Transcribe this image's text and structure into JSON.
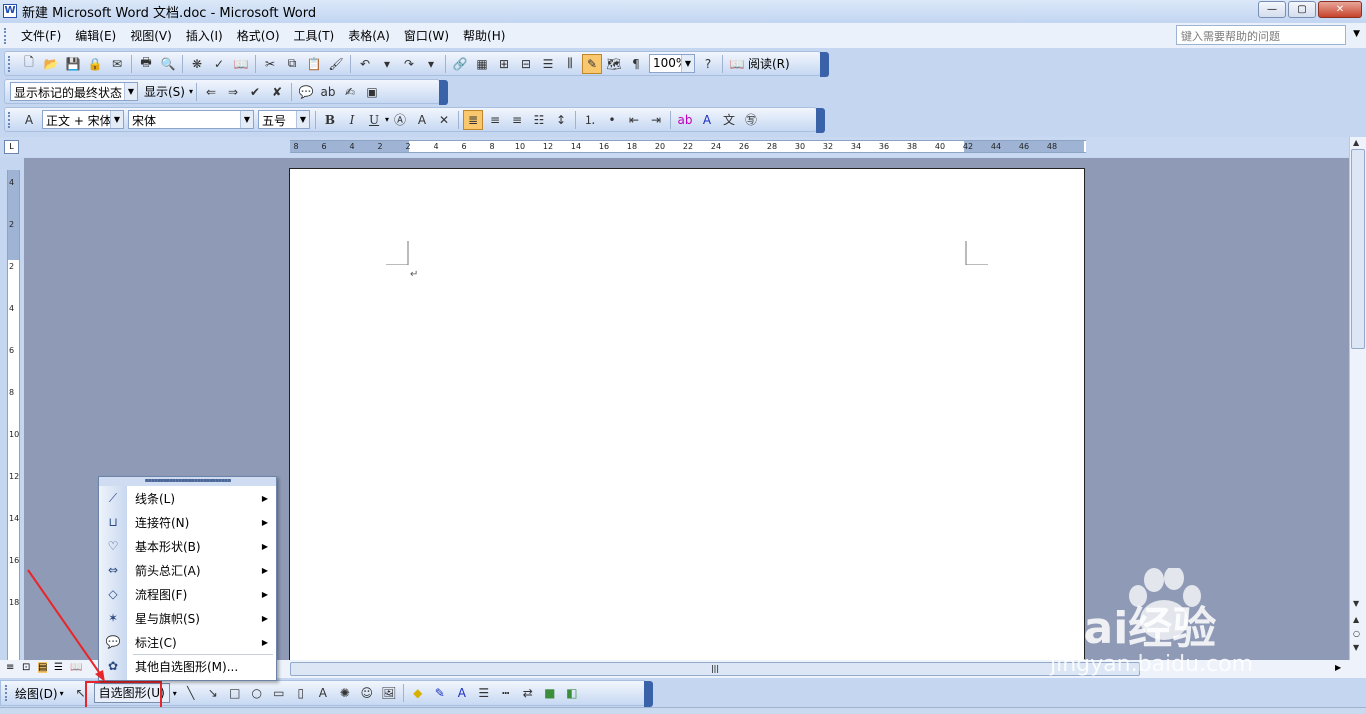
{
  "window": {
    "title": "新建 Microsoft Word 文档.doc - Microsoft Word",
    "app_icon_glyph": "W",
    "controls": {
      "minimize": "—",
      "maximize": "▢",
      "close": "✕"
    }
  },
  "menubar": {
    "items": [
      "文件(F)",
      "编辑(E)",
      "视图(V)",
      "插入(I)",
      "格式(O)",
      "工具(T)",
      "表格(A)",
      "窗口(W)",
      "帮助(H)"
    ],
    "help_placeholder": "键入需要帮助的问题"
  },
  "standard_toolbar": {
    "zoom": "100%",
    "read_label": "阅读(R)"
  },
  "reviewing_toolbar": {
    "markup_mode": "显示标记的最终状态",
    "show_label": "显示(S)"
  },
  "formatting_toolbar": {
    "style": "正文 + 宋体",
    "font": "宋体",
    "size": "五号",
    "bold": "B",
    "italic": "I",
    "underline": "U"
  },
  "ruler": {
    "horizontal_ticks": [
      "8",
      "6",
      "4",
      "2",
      "2",
      "4",
      "6",
      "8",
      "10",
      "12",
      "14",
      "16",
      "18",
      "20",
      "22",
      "24",
      "26",
      "28",
      "30",
      "32",
      "34",
      "36",
      "38",
      "40",
      "42",
      "44",
      "46",
      "48"
    ],
    "vertical_ticks": [
      "4",
      "2",
      "2",
      "4",
      "6",
      "8",
      "10",
      "12",
      "14",
      "16",
      "18"
    ]
  },
  "document": {
    "paragraph_mark": "↵"
  },
  "draw_toolbar": {
    "draw_label": "绘图(D)",
    "autoshape_label": "自选图形(U)"
  },
  "autoshape_menu": {
    "items": [
      {
        "label": "线条(L)",
        "icon": "lines-icon",
        "submenu": true
      },
      {
        "label": "连接符(N)",
        "icon": "connectors-icon",
        "submenu": true
      },
      {
        "label": "基本形状(B)",
        "icon": "basic-shapes-icon",
        "submenu": true
      },
      {
        "label": "箭头总汇(A)",
        "icon": "block-arrows-icon",
        "submenu": true
      },
      {
        "label": "流程图(F)",
        "icon": "flowchart-icon",
        "submenu": true
      },
      {
        "label": "星与旗帜(S)",
        "icon": "stars-banners-icon",
        "submenu": true
      },
      {
        "label": "标注(C)",
        "icon": "callouts-icon",
        "submenu": true
      },
      {
        "label": "其他自选图形(M)...",
        "icon": "more-autoshapes-icon",
        "submenu": false
      }
    ]
  },
  "watermark": {
    "brand": "Bai经验",
    "url": "jingyan.baidu.com"
  }
}
